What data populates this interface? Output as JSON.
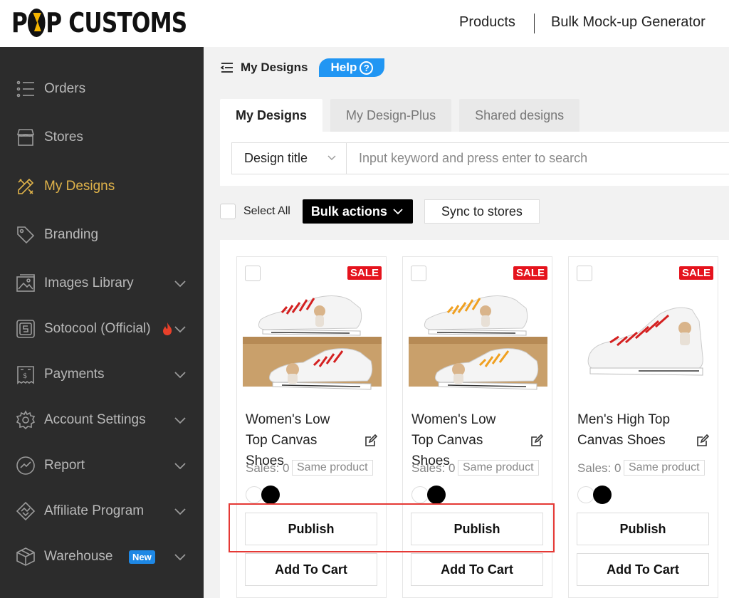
{
  "header": {
    "logo_text_1": "P",
    "logo_text_2": "P CUSTOMS",
    "nav": [
      "Products",
      "Bulk Mock-up Generator"
    ]
  },
  "sidebar": {
    "items": [
      {
        "label": "Orders",
        "icon": "list-icon"
      },
      {
        "label": "Stores",
        "icon": "store-icon"
      },
      {
        "label": "My Designs",
        "icon": "design-tools-icon",
        "active": true
      },
      {
        "label": "Branding",
        "icon": "tag-icon"
      },
      {
        "label": "Images Library",
        "icon": "image-folder-icon",
        "has_chevron": true
      },
      {
        "label": "Sotocool (Official)",
        "icon": "s-logo-icon",
        "has_chevron": true,
        "fire": true
      },
      {
        "label": "Payments",
        "icon": "receipt-icon",
        "has_chevron": true
      },
      {
        "label": "Account Settings",
        "icon": "gear-icon",
        "has_chevron": true
      },
      {
        "label": "Report",
        "icon": "chart-icon",
        "has_chevron": true
      },
      {
        "label": "Affiliate Program",
        "icon": "handshake-icon",
        "has_chevron": true
      },
      {
        "label": "Warehouse",
        "icon": "box-icon",
        "has_chevron": true,
        "badge": "New"
      }
    ],
    "active_color": "#e0b34a"
  },
  "main": {
    "breadcrumb_title": "My Designs",
    "help_label": "Help",
    "tabs": [
      {
        "label": "My Designs",
        "active": true
      },
      {
        "label": "My Design-Plus"
      },
      {
        "label": "Shared designs"
      }
    ],
    "search": {
      "select_value": "Design title",
      "placeholder": "Input keyword and press enter to search"
    },
    "actions": {
      "select_all": "Select All",
      "bulk_actions": "Bulk actions",
      "sync": "Sync to stores"
    },
    "cards": [
      {
        "name": "Women's Low Top Canvas Shoes",
        "sale": "SALE",
        "sales": "Sales: 0",
        "same": "Same product",
        "publish": "Publish",
        "cart": "Add To Cart",
        "lace_color": "#d42020"
      },
      {
        "name": "Women's Low Top Canvas Shoes",
        "sale": "SALE",
        "sales": "Sales: 0",
        "same": "Same product",
        "publish": "Publish",
        "cart": "Add To Cart",
        "lace_color": "#f0a020"
      },
      {
        "name": "Men's High Top Canvas Shoes",
        "sale": "SALE",
        "sales": "Sales: 0",
        "same": "Same product",
        "publish": "Publish",
        "cart": "Add To Cart",
        "lace_color": "#d42020"
      }
    ]
  }
}
